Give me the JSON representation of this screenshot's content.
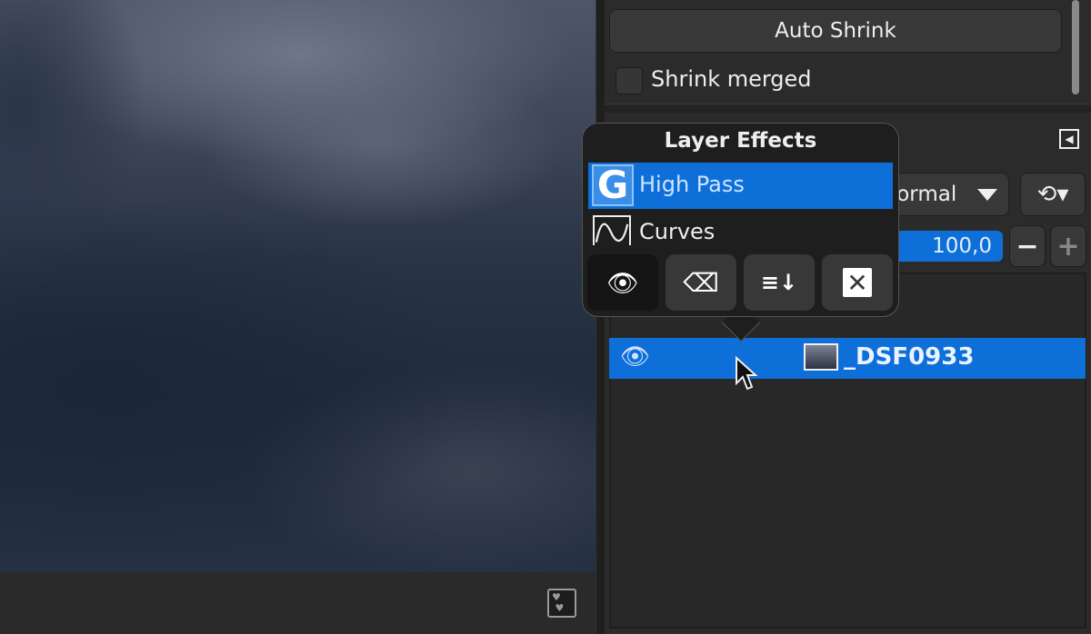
{
  "canvas": {
    "status_icon": "navigation-hearts-icon"
  },
  "tool_options": {
    "auto_shrink_label": "Auto Shrink",
    "shrink_merged_label": "Shrink merged",
    "shrink_merged_checked": false
  },
  "layers": {
    "mode": "Normal",
    "opacity": "100,0",
    "minus": "−",
    "plus": "+",
    "rows": [
      {
        "name": "_DSF0933",
        "visible": true,
        "selected": true
      }
    ]
  },
  "popover": {
    "title": "Layer Effects",
    "effects": [
      {
        "label": "High Pass",
        "selected": true
      },
      {
        "label": "Curves",
        "selected": false
      }
    ],
    "buttons": [
      "toggle-visibility",
      "delete-effect",
      "merge-effects",
      "remove-all-effects"
    ]
  },
  "colors": {
    "accent": "#0f6fd9",
    "panel": "#2b2b2b",
    "popover": "#1e1e1e"
  }
}
